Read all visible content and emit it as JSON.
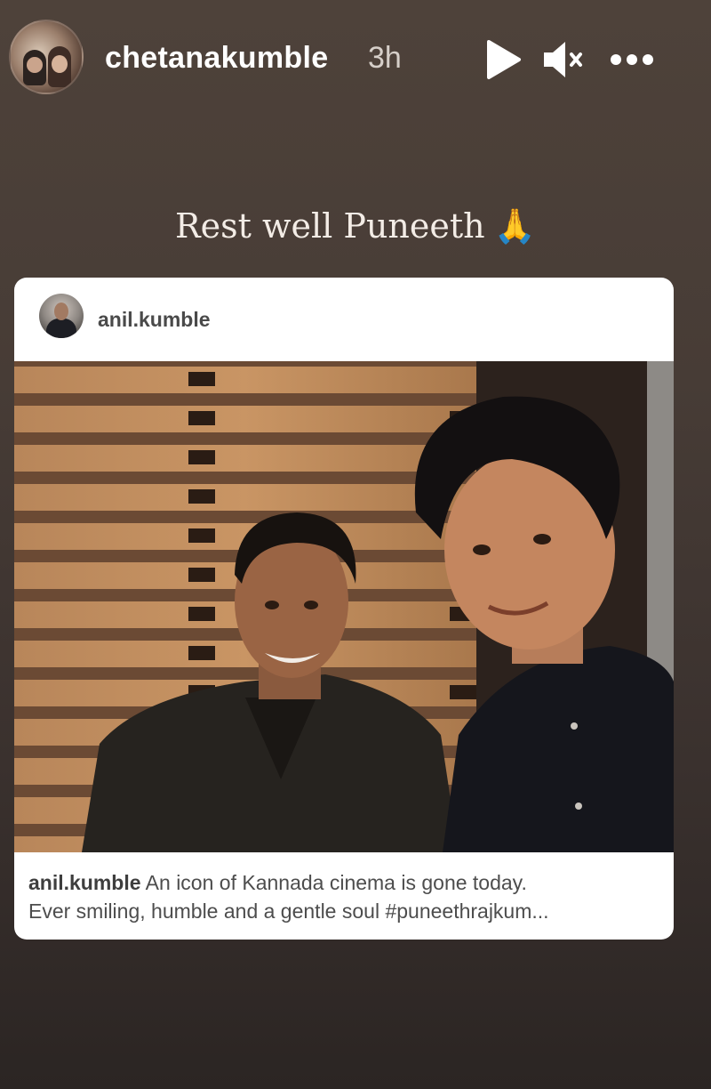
{
  "story": {
    "username": "chetanakumble",
    "time": "3h",
    "caption": "Rest well Puneeth",
    "caption_emoji": "🙏"
  },
  "icons": {
    "play": "play-icon",
    "mute": "speaker-muted-icon",
    "more": "more-options-icon"
  },
  "shared_post": {
    "username": "anil.kumble",
    "caption_line1": "An icon of Kannada cinema is gone today.",
    "caption_line2": "Ever smiling, humble and a gentle soul #puneethrajkum..."
  },
  "colors": {
    "background_top": "#4e423a",
    "background_bottom": "#2b2523",
    "text_primary": "#ffffff",
    "card_background": "#ffffff"
  }
}
